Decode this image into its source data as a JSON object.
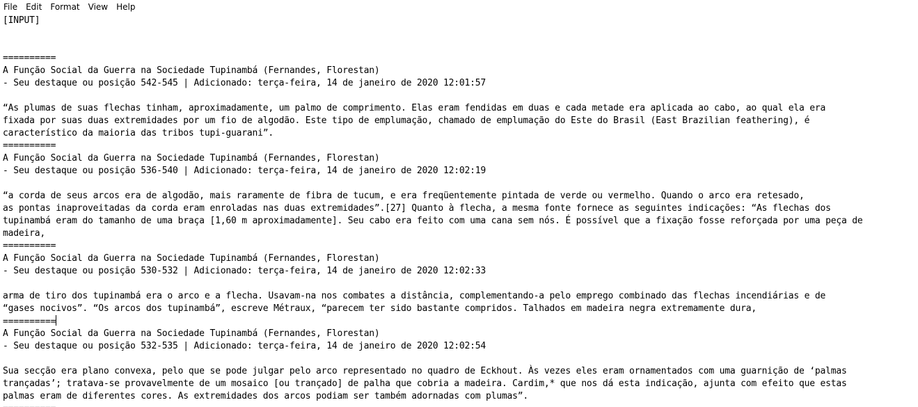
{
  "menubar": {
    "items": [
      {
        "label": "File"
      },
      {
        "label": "Edit"
      },
      {
        "label": "Format"
      },
      {
        "label": "View"
      },
      {
        "label": "Help"
      }
    ]
  },
  "editor": {
    "lines": [
      "[INPUT]",
      "",
      "",
      "==========",
      "A Função Social da Guerra na Sociedade Tupinambá (Fernandes, Florestan)",
      "- Seu destaque ou posição 542-545 | Adicionado: terça-feira, 14 de janeiro de 2020 12:01:57",
      "",
      "“As plumas de suas flechas tinham, aproximadamente, um palmo de comprimento. Elas eram fendidas em duas e cada metade era aplicada ao cabo, ao qual ela era",
      "fixada por suas duas extremidades por um fio de algodão. Este tipo de emplumação, chamado de emplumação do Este do Brasil (East Brazilian feathering), é",
      "característico da maioria das tribos tupi-guarani”.",
      "==========",
      "A Função Social da Guerra na Sociedade Tupinambá (Fernandes, Florestan)",
      "- Seu destaque ou posição 536-540 | Adicionado: terça-feira, 14 de janeiro de 2020 12:02:19",
      "",
      "“a corda de seus arcos era de algodão, mais raramente de fibra de tucum, e era freqüentemente pintada de verde ou vermelho. Quando o arco era retesado,",
      "as pontas inaproveitadas da corda eram enroladas nas duas extremidades”.[27] Quanto à flecha, a mesma fonte fornece as seguintes indicações: “As flechas dos",
      "tupinambá eram do tamanho de uma braça [1,60 m aproximadamente]. Seu cabo era feito com uma cana sem nós. É possível que a fixação fosse reforçada por uma peça de",
      "madeira,",
      "==========",
      "A Função Social da Guerra na Sociedade Tupinambá (Fernandes, Florestan)",
      "- Seu destaque ou posição 530-532 | Adicionado: terça-feira, 14 de janeiro de 2020 12:02:33",
      "",
      "arma de tiro dos tupinambá era o arco e a flecha. Usavam-na nos combates a distância, complementando-a pelo emprego combinado das flechas incendiárias e de",
      "“gases nocivos”. “Os arcos dos tupinambá”, escreve Métraux, “parecem ter sido bastante compridos. Talhados em madeira negra extremamente dura,",
      "==========",
      "A Função Social da Guerra na Sociedade Tupinambá (Fernandes, Florestan)",
      "- Seu destaque ou posição 532-535 | Adicionado: terça-feira, 14 de janeiro de 2020 12:02:54",
      "",
      "Sua secção era plano convexa, pelo que se pode julgar pelo arco representado no quadro de Eckhout. Às vezes eles eram ornamentados com uma guarnição de ‘palmas",
      "trançadas’; tratava-se provavelmente de um mosaico [ou trançado] de palha que cobria a madeira. Cardim,* que nos dá esta indicação, ajunta com efeito que estas",
      "palmas eram de diferentes cores. As extremidades dos arcos podiam ser também adornadas com plumas”.",
      "=========="
    ]
  }
}
